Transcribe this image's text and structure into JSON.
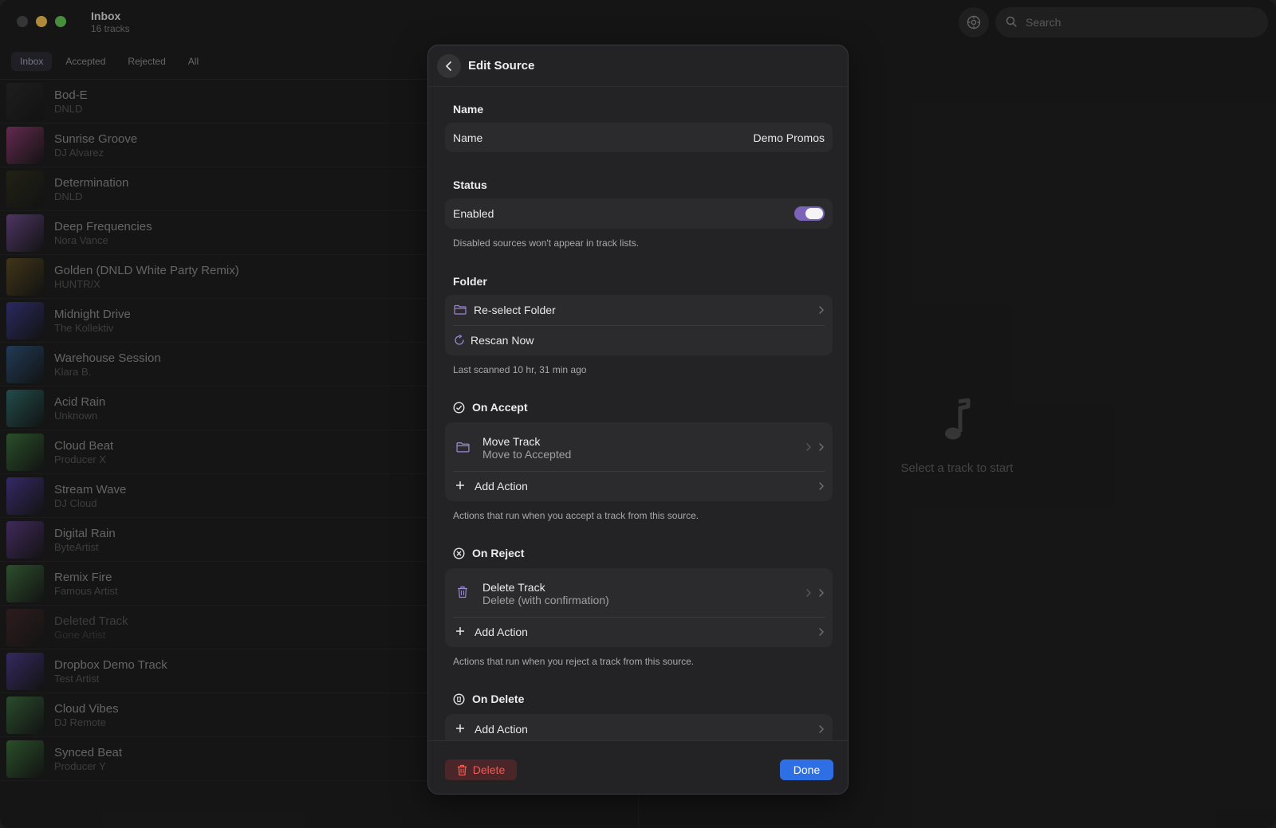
{
  "window": {
    "title": "Inbox",
    "subtitle": "16 tracks"
  },
  "search": {
    "placeholder": "Search",
    "icon": "magnifier-icon"
  },
  "tabs": [
    {
      "label": "Inbox",
      "active": true
    },
    {
      "label": "Accepted",
      "active": false
    },
    {
      "label": "Rejected",
      "active": false
    },
    {
      "label": "All",
      "active": false
    }
  ],
  "tracks": [
    {
      "title": "Bod-E",
      "artist": "DNLD",
      "color": "#2a2a2a",
      "dimmed": false
    },
    {
      "title": "Sunrise Groove",
      "artist": "DJ Alvarez",
      "color": "#8a3a6e",
      "dimmed": false
    },
    {
      "title": "Determination",
      "artist": "DNLD",
      "color": "#2f2f1e",
      "dimmed": false
    },
    {
      "title": "Deep Frequencies",
      "artist": "Nora Vance",
      "color": "#6c4a8a",
      "dimmed": false
    },
    {
      "title": "Golden (DNLD White Party Remix)",
      "artist": "HUNTR/X",
      "color": "#5a4a22",
      "dimmed": false
    },
    {
      "title": "Midnight Drive",
      "artist": "The Kollektiv",
      "color": "#3a3a86",
      "dimmed": false
    },
    {
      "title": "Warehouse Session",
      "artist": "Klara B.",
      "color": "#2e5278",
      "dimmed": false
    },
    {
      "title": "Acid Rain",
      "artist": "Unknown",
      "color": "#2e6a68",
      "dimmed": false
    },
    {
      "title": "Cloud Beat",
      "artist": "Producer X",
      "color": "#3a6e3a",
      "dimmed": false
    },
    {
      "title": "Stream Wave",
      "artist": "DJ Cloud",
      "color": "#4a3a8e",
      "dimmed": false
    },
    {
      "title": "Digital Rain",
      "artist": "ByteArtist",
      "color": "#5a3a7e",
      "dimmed": false
    },
    {
      "title": "Remix Fire",
      "artist": "Famous Artist",
      "color": "#3e6e3e",
      "dimmed": false
    },
    {
      "title": "Deleted Track",
      "artist": "Gone Artist",
      "color": "#5a2e34",
      "dimmed": true
    },
    {
      "title": "Dropbox Demo Track",
      "artist": "Test Artist",
      "color": "#4a3a86",
      "dimmed": false
    },
    {
      "title": "Cloud Vibes",
      "artist": "DJ Remote",
      "color": "#3a6a3e",
      "dimmed": false
    },
    {
      "title": "Synced Beat",
      "artist": "Producer Y",
      "color": "#3a6e3a",
      "dimmed": false
    }
  ],
  "empty_state": {
    "text": "Select a track to start",
    "icon": "music-note-icon"
  },
  "sheet": {
    "title": "Edit Source",
    "name_section": {
      "header": "Name",
      "label": "Name",
      "value": "Demo Promos"
    },
    "status_section": {
      "header": "Status",
      "label": "Enabled",
      "enabled": true,
      "note": "Disabled sources won't appear in track lists."
    },
    "folder_section": {
      "header": "Folder",
      "reselect_label": "Re-select Folder",
      "rescan_label": "Rescan Now",
      "note": "Last scanned 10 hr, 31 min ago"
    },
    "on_accept": {
      "header": "On Accept",
      "action_title": "Move Track",
      "action_sub": "Move to Accepted",
      "add_label": "Add Action",
      "note": "Actions that run when you accept a track from this source."
    },
    "on_reject": {
      "header": "On Reject",
      "action_title": "Delete Track",
      "action_sub": "Delete (with confirmation)",
      "add_label": "Add Action",
      "note": "Actions that run when you reject a track from this source."
    },
    "on_delete": {
      "header": "On Delete",
      "add_label": "Add Action"
    },
    "footer": {
      "delete_label": "Delete",
      "done_label": "Done"
    }
  },
  "colors": {
    "accent": "#2f6fe6",
    "toggle": "#7a63b8",
    "destructive": "#ef5b57"
  }
}
